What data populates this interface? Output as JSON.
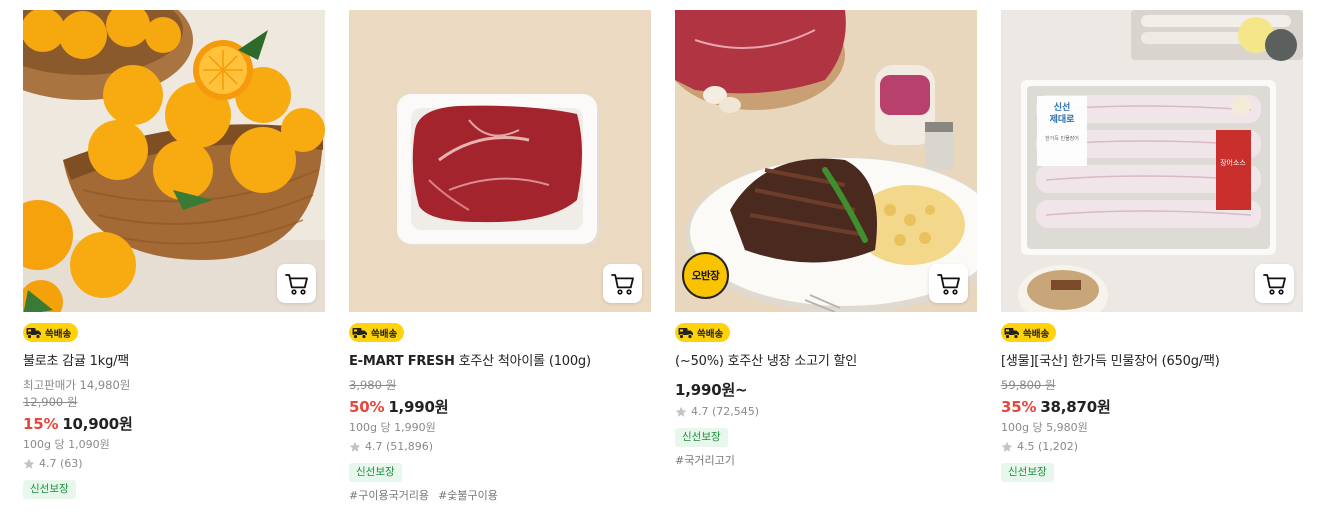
{
  "colors": {
    "accent_red": "#e8453c",
    "ship_yellow": "#ffd20a",
    "fresh_green": "#1f8f3f"
  },
  "products": [
    {
      "shipping_label": "쓱배송",
      "title": "불로초 감귤 1kg/팩",
      "max_price_text": "최고판매가 14,980원",
      "original_price": "12,900 원",
      "discount": "15%",
      "price": "10,900원",
      "unit_price": "100g 당 1,090원",
      "rating": "4.7 (63)",
      "fresh_badge": "신선보장",
      "cart_icon": "cart-icon"
    },
    {
      "shipping_label": "쓱배송",
      "brand": "E-MART FRESH",
      "title": "호주산 척아이롤 (100g)",
      "original_price": "3,980 원",
      "discount": "50%",
      "price": "1,990원",
      "unit_price": "100g 당 1,990원",
      "rating": "4.7 (51,896)",
      "fresh_badge": "신선보장",
      "tags": [
        "#구이용국거리용",
        "#숯불구이용"
      ],
      "cart_icon": "cart-icon"
    },
    {
      "shipping_label": "쓱배송",
      "image_badge": "오반장",
      "title": "(~50%) 호주산 냉장 소고기 할인",
      "price": "1,990원~",
      "rating": "4.7 (72,545)",
      "fresh_badge": "신선보장",
      "tags": [
        "#국거리고기"
      ],
      "cart_icon": "cart-icon"
    },
    {
      "shipping_label": "쓱배송",
      "title": "[생물][국산] 한가득 민물장어 (650g/팩)",
      "original_price": "59,800 원",
      "discount": "35%",
      "price": "38,870원",
      "unit_price": "100g 당 5,980원",
      "rating": "4.5 (1,202)",
      "fresh_badge": "신선보장",
      "cart_icon": "cart-icon",
      "package_text": [
        "신선",
        "제대로",
        "한가득 민물장어",
        "장어소스"
      ]
    }
  ]
}
